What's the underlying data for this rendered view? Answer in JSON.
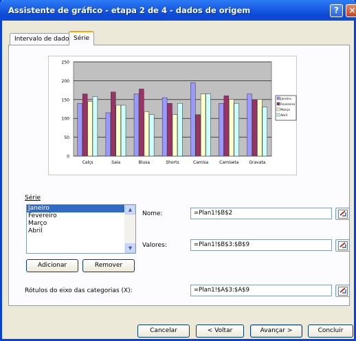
{
  "window": {
    "title": "Assistente de gráfico - etapa 2 de 4 - dados de origem",
    "help_label": "?",
    "close_label": "×"
  },
  "tabs": [
    {
      "label": "Intervalo de dados",
      "active": false
    },
    {
      "label": "Série",
      "active": true
    }
  ],
  "chart_data": {
    "type": "bar",
    "categories": [
      "Calçs",
      "Saia",
      "Blusa",
      "Shorts",
      "Camisa",
      "Camiseta",
      "Gravata"
    ],
    "series": [
      {
        "name": "Janeiro",
        "color": "#9999ff",
        "values": [
          140,
          115,
          165,
          155,
          195,
          140,
          165
        ]
      },
      {
        "name": "Fevereiro",
        "color": "#993366",
        "values": [
          165,
          170,
          178,
          140,
          110,
          160,
          150
        ]
      },
      {
        "name": "Março",
        "color": "#ffffcc",
        "values": [
          145,
          135,
          118,
          110,
          165,
          150,
          150
        ]
      },
      {
        "name": "Abril",
        "color": "#ccffff",
        "values": [
          158,
          135,
          110,
          140,
          165,
          140,
          130
        ]
      }
    ],
    "yticks": [
      "0",
      "50",
      "100",
      "150",
      "200",
      "250"
    ],
    "ylim": [
      0,
      250
    ],
    "grid": true,
    "plot_background": "#c0c0c0",
    "legend": "right"
  },
  "serie": {
    "section_label": "Série",
    "items": [
      "Janeiro",
      "Fevereiro",
      "Março",
      "Abril"
    ],
    "selected": "Janeiro",
    "add_label": "Adicionar",
    "remove_label": "Remover"
  },
  "fields": {
    "name_label": "Nome:",
    "name_value": "=Plan1!$B$2",
    "values_label": "Valores:",
    "values_value": "=Plan1!$B$3:$B$9",
    "category_label": "Rótulos do eixo das categorias (X):",
    "category_value": "=Plan1!$A$3:$A$9"
  },
  "footer": {
    "cancel": "Cancelar",
    "back": "< Voltar",
    "next": "Avançar >",
    "finish": "Concluir"
  },
  "colors": {
    "title_bar": "#0c48d4",
    "dialog_bg": "#ece9d8",
    "selection": "#316ac5"
  }
}
